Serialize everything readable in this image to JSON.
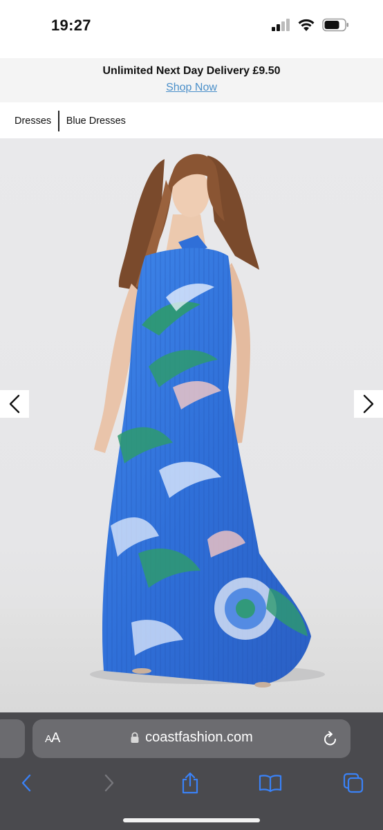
{
  "status_bar": {
    "time": "19:27"
  },
  "promo": {
    "title": "Unlimited Next Day Delivery £9.50",
    "link_label": "Shop Now"
  },
  "breadcrumb": {
    "items": [
      {
        "label": "Dresses"
      },
      {
        "label": "Blue Dresses"
      }
    ]
  },
  "gallery": {
    "image_alt": "Blue floral print pleated halter maxi dress",
    "prev_icon": "chevron-left-icon",
    "next_icon": "chevron-right-icon"
  },
  "browser": {
    "aa_label_small": "A",
    "aa_label_large": "A",
    "url": "coastfashion.com",
    "colors": {
      "chrome": "#4a4a4e",
      "address": "#6c6c70",
      "accent": "#3a82f7"
    }
  },
  "colors": {
    "link": "#4a8fc9",
    "dress_blue": "#2f6fd8",
    "dress_green": "#2e9a6e"
  }
}
